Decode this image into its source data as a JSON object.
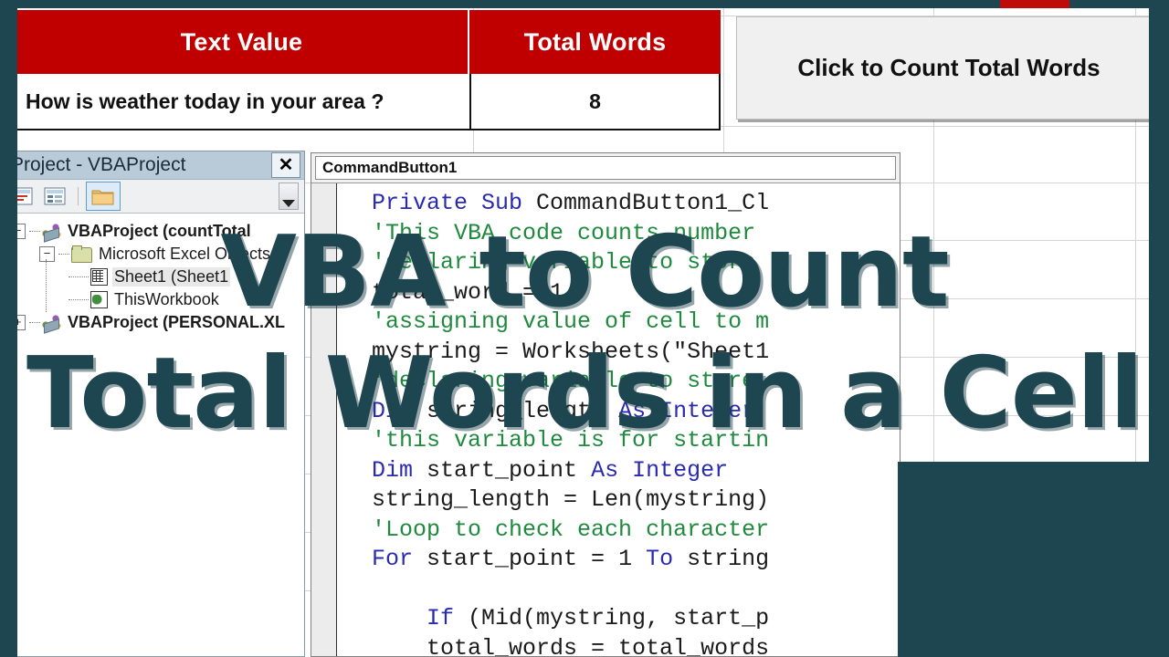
{
  "colors": {
    "brand_teal": "#1d4651",
    "header_red": "#c00000",
    "button_face": "#f0f0f0",
    "vbe_title_bar": "#b9cbd8",
    "code_keyword": "#2a2ab0",
    "code_comment": "#1f8a3d"
  },
  "overlay": {
    "line1": "VBA to Count",
    "line2": "Total Words in a Cell"
  },
  "excel": {
    "headers": [
      "Text Value",
      "Total Words"
    ],
    "row": {
      "text_value": "How is weather today in your area ?",
      "total_words": "8"
    },
    "command_button": {
      "label": "Click to Count Total Words"
    }
  },
  "project_explorer": {
    "title": "Project - VBAProject",
    "close_label": "✕",
    "toolbar": {
      "view_code_icon": "view-code-icon",
      "view_object_icon": "view-object-icon",
      "toggle_folders_icon": "toggle-folders-icon",
      "scroll_icon": "scroll-down-icon"
    },
    "tree": [
      {
        "label": "VBAProject (countTotal",
        "toggle": "−",
        "icon": "project-icon",
        "bold": true,
        "depth": 0,
        "selected": false
      },
      {
        "label": "Microsoft Excel Objects",
        "toggle": "−",
        "icon": "folder-icon",
        "bold": false,
        "depth": 1,
        "selected": false
      },
      {
        "label": "Sheet1 (Sheet1",
        "toggle": "",
        "icon": "worksheet-icon",
        "bold": false,
        "depth": 2,
        "selected": true
      },
      {
        "label": "ThisWorkbook",
        "toggle": "",
        "icon": "workbook-icon",
        "bold": false,
        "depth": 2,
        "selected": false
      },
      {
        "label": "VBAProject (PERSONAL.XL",
        "toggle": "+",
        "icon": "project-icon",
        "bold": true,
        "depth": 0,
        "selected": false
      }
    ]
  },
  "code_window": {
    "dropdown_value": "CommandButton1",
    "lines": [
      {
        "indent": 1,
        "parts": [
          {
            "t": "kw",
            "s": "Private Sub "
          },
          {
            "t": "tx",
            "s": "CommandButton1_Cl"
          }
        ]
      },
      {
        "indent": 1,
        "parts": [
          {
            "t": "cm",
            "s": "'This VBA code counts number"
          }
        ]
      },
      {
        "indent": 1,
        "parts": [
          {
            "t": "cm",
            "s": "'declaring variable to store"
          }
        ]
      },
      {
        "indent": 1,
        "parts": [
          {
            "t": "tx",
            "s": "total_word = 1"
          }
        ]
      },
      {
        "indent": 1,
        "parts": [
          {
            "t": "cm",
            "s": "'assigning value of cell to m"
          }
        ]
      },
      {
        "indent": 1,
        "parts": [
          {
            "t": "tx",
            "s": "mystring = Worksheets(\"Sheet1"
          }
        ]
      },
      {
        "indent": 1,
        "parts": [
          {
            "t": "cm",
            "s": "'declaring variable to store"
          }
        ]
      },
      {
        "indent": 1,
        "parts": [
          {
            "t": "kw",
            "s": "Dim "
          },
          {
            "t": "tx",
            "s": "string_length "
          },
          {
            "t": "kw",
            "s": "As Integer"
          }
        ]
      },
      {
        "indent": 1,
        "parts": [
          {
            "t": "cm",
            "s": "'this variable is for startin"
          }
        ]
      },
      {
        "indent": 1,
        "parts": [
          {
            "t": "kw",
            "s": "Dim "
          },
          {
            "t": "tx",
            "s": "start_point "
          },
          {
            "t": "kw",
            "s": "As Integer"
          }
        ]
      },
      {
        "indent": 1,
        "parts": [
          {
            "t": "tx",
            "s": "string_length = Len(mystring)"
          }
        ]
      },
      {
        "indent": 1,
        "parts": [
          {
            "t": "cm",
            "s": "'Loop to check each character"
          }
        ]
      },
      {
        "indent": 1,
        "parts": [
          {
            "t": "kw",
            "s": "For "
          },
          {
            "t": "tx",
            "s": "start_point = 1 "
          },
          {
            "t": "kw",
            "s": "To "
          },
          {
            "t": "tx",
            "s": "string"
          }
        ]
      },
      {
        "indent": 1,
        "parts": [
          {
            "t": "tx",
            "s": ""
          }
        ]
      },
      {
        "indent": 3,
        "parts": [
          {
            "t": "kw",
            "s": "If "
          },
          {
            "t": "tx",
            "s": "(Mid(mystring, start_p"
          }
        ]
      },
      {
        "indent": 3,
        "parts": [
          {
            "t": "tx",
            "s": "total_words = total_words"
          }
        ]
      }
    ]
  }
}
